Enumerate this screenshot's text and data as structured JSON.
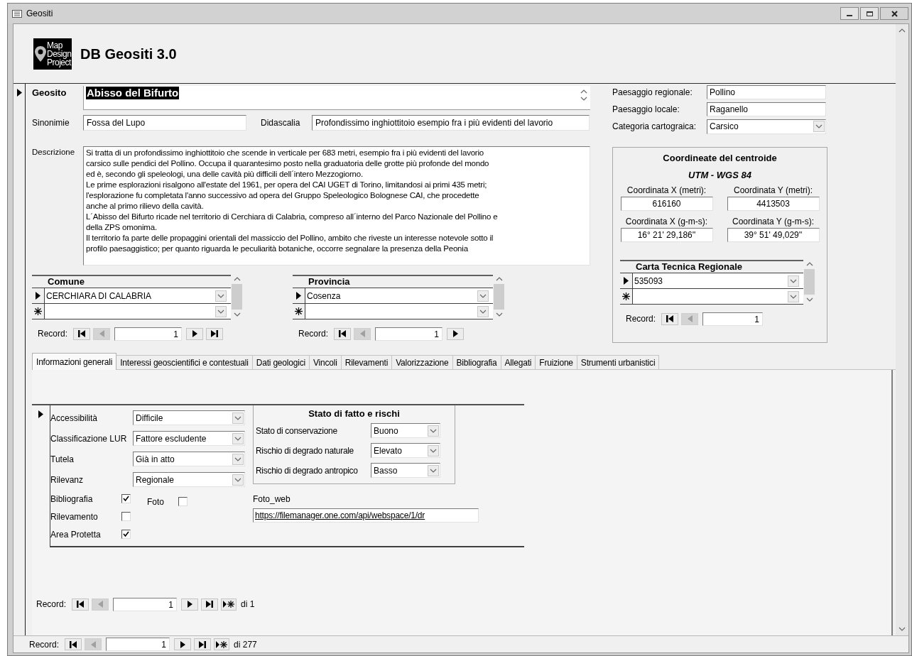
{
  "window": {
    "title": "Geositi"
  },
  "header": {
    "logo_lines": [
      "Map",
      "Design",
      "Project"
    ],
    "title": "DB Geositi 3.0"
  },
  "geosito": {
    "label": "Geosito",
    "value": "Abisso del Bifurto",
    "selected": true
  },
  "fields": [
    {
      "label": "Sinonimie",
      "value": "Fossa del Lupo"
    },
    {
      "label": "Didascalia",
      "value": "Profondissimo inghiottitoio esempio fra i più evidenti del lavorio"
    }
  ],
  "description": {
    "label": "Descrizione",
    "lines": [
      "Si tratta di un profondissimo inghiottitoio che scende in verticale per 683 metri, esempio fra i più evidenti del lavorio",
      "carsico sulle pendici del Pollino. Occupa il quarantesimo posto nella graduatoria delle grotte più profonde del mondo",
      "ed è, secondo gli speleologi, una delle cavità più difficili dell´intero Mezzogiorno.",
      "Le prime esplorazioni risalgono all'estate del 1961, per opera del CAI UGET di Torino, limitandosi ai primi 435 metri;",
      "l'esplorazione fu completata l'anno successivo ad opera del Gruppo Speleologico Bolognese CAI, che procedette",
      "anche al primo rilievo della cavità.",
      "L´Abisso del Bifurto ricade nel territorio di Cerchiara di Calabria, compreso all´interno del Parco Nazionale del Pollino e",
      "della ZPS omonima.",
      "Il territorio fa parte delle propaggini orientali del massiccio del Pollino, ambito che riveste un interesse notevole sotto il",
      "profilo paesaggistico; per quanto riguarda le peculiarità botaniche, occorre segnalare la presenza della Peonia"
    ]
  },
  "landscape": [
    {
      "label": "Paesaggio regionale:",
      "value": "Pollino",
      "kind": "text"
    },
    {
      "label": "Paesaggio locale:",
      "value": "Raganello",
      "kind": "text"
    },
    {
      "label": "Categoria cartograica:",
      "value": "Carsico",
      "kind": "combo"
    }
  ],
  "coordinates": {
    "title": "Coordineate del centroide",
    "subtitle": "UTM - WGS 84",
    "fields": [
      {
        "label": "Coordinata X (metri):",
        "value": "616160"
      },
      {
        "label": "Coordinata Y (metri):",
        "value": "4413503"
      },
      {
        "label": "Coordinata X (g-m-s):",
        "value": "16° 21' 29,186''"
      },
      {
        "label": "Coordinata Y (g-m-s):",
        "value": "39° 51' 49,029''"
      }
    ],
    "subform": {
      "column": "Carta Tecnica Regionale",
      "rows": [
        {
          "kind": "current",
          "value": "535093"
        },
        {
          "kind": "new"
        }
      ],
      "nav": {
        "label": "Record:",
        "current": "1",
        "buttons": [
          {
            "kind": "first",
            "disabled": false
          },
          {
            "kind": "previous",
            "disabled": true
          }
        ]
      }
    }
  },
  "subforms": [
    {
      "column": "Comune",
      "rows": [
        {
          "kind": "current",
          "value": "CERCHIARA DI CALABRIA"
        },
        {
          "kind": "new"
        }
      ],
      "nav": {
        "label": "Record:",
        "current": "1",
        "buttons": [
          {
            "kind": "first",
            "disabled": false
          },
          {
            "kind": "previous",
            "disabled": true
          },
          {
            "kind": "next",
            "disabled": false
          },
          {
            "kind": "last",
            "disabled": false
          }
        ]
      }
    },
    {
      "column": "Provincia",
      "rows": [
        {
          "kind": "current",
          "value": "Cosenza"
        },
        {
          "kind": "new"
        }
      ],
      "nav": {
        "label": "Record:",
        "current": "1",
        "buttons": [
          {
            "kind": "first",
            "disabled": false
          },
          {
            "kind": "previous",
            "disabled": true
          },
          {
            "kind": "next",
            "disabled": false
          }
        ]
      }
    }
  ],
  "tabs": [
    {
      "label": "Informazioni generali",
      "selected": true
    },
    {
      "label": "Interessi geoscientifici e contestuali",
      "selected": false
    },
    {
      "label": "Dati geologici",
      "selected": false
    },
    {
      "label": "Vincoli",
      "selected": false
    },
    {
      "label": "Rilevamenti",
      "selected": false
    },
    {
      "label": "Valorizzazione",
      "selected": false
    },
    {
      "label": "Bibliografia",
      "selected": false
    },
    {
      "label": "Allegati",
      "selected": false
    },
    {
      "label": "Fruizione",
      "selected": false
    },
    {
      "label": "Strumenti urbanistici",
      "selected": false
    }
  ],
  "tab_panel": {
    "fields": [
      {
        "label": "Accessibilità",
        "value": "Difficile"
      },
      {
        "label": "Classificazione LUR",
        "value": "Fattore escludente"
      },
      {
        "label": "Tutela",
        "value": "Già in atto"
      },
      {
        "label": "Rilevanz",
        "value": "Regionale"
      }
    ],
    "checkboxes": [
      {
        "label": "Bibliografia",
        "checked": true
      },
      {
        "label": "Rilevamento",
        "checked": false
      },
      {
        "label": "Area Protetta",
        "checked": true
      }
    ],
    "photo_checkbox": {
      "label": "Foto",
      "checked": false
    },
    "status": {
      "title": "Stato di fatto e rischi",
      "fields": [
        {
          "label": "Stato di conservazione",
          "value": "Buono"
        },
        {
          "label": "Rischio di degrado naturale",
          "value": "Elevato"
        },
        {
          "label": "Rischio di degrado antropico",
          "value": "Basso"
        }
      ]
    },
    "photo_link": {
      "label": "Foto_web",
      "value": "https://filemanager.one.com/api/webspace/1/dr"
    },
    "nav": {
      "label": "Record:",
      "current": "1",
      "buttons": [
        {
          "kind": "first",
          "disabled": false
        },
        {
          "kind": "previous",
          "disabled": true
        },
        {
          "kind": "next",
          "disabled": false
        },
        {
          "kind": "last",
          "disabled": false
        },
        {
          "kind": "new",
          "disabled": false
        }
      ],
      "total": "di 1"
    }
  },
  "nav": {
    "label": "Record:",
    "current": "1",
    "buttons": [
      {
        "kind": "first",
        "disabled": false
      },
      {
        "kind": "previous",
        "disabled": true
      },
      {
        "kind": "next",
        "disabled": false
      },
      {
        "kind": "last",
        "disabled": false
      },
      {
        "kind": "new",
        "disabled": false
      }
    ],
    "total": "di 277"
  }
}
